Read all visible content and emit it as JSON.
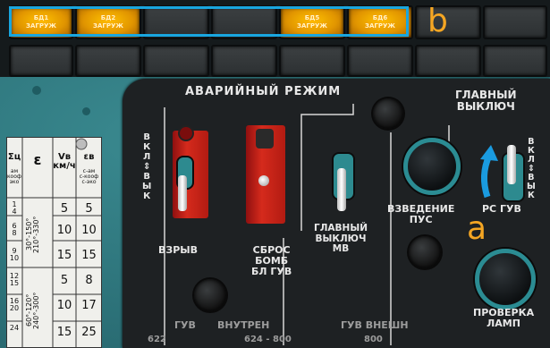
{
  "annunciators": {
    "row1": [
      {
        "label1": "БД1",
        "label2": "ЗАГРУЖ",
        "lit": true
      },
      {
        "label1": "БД2",
        "label2": "ЗАГРУЖ",
        "lit": true
      },
      {
        "label1": "",
        "label2": "",
        "lit": false
      },
      {
        "label1": "",
        "label2": "",
        "lit": false
      },
      {
        "label1": "БД5",
        "label2": "ЗАГРУЖ",
        "lit": true
      },
      {
        "label1": "БД6",
        "label2": "ЗАГРУЖ",
        "lit": true
      },
      {
        "label1": "",
        "label2": "",
        "lit": false
      },
      {
        "label1": "",
        "label2": "",
        "lit": false
      }
    ],
    "highlight_color": "#19a6df"
  },
  "callouts": {
    "b": "b",
    "a": "a",
    "color": "#f5a623"
  },
  "panel": {
    "title": "АВАРИЙНЫЙ РЕЖИМ",
    "main_switch_title": "ГЛАВНЫЙ\nВЫКЛЮЧ",
    "vkl_vykl_left": "В\nК\nЛ\n⇕\nВ\nЫ\nК",
    "vkl_vykl_right": "В\nК\nЛ\n⇕\nВ\nЫ\nК",
    "explosion": "ВЗРЫВ",
    "bomb_reset": "СБРОС\nБОМБ\nБЛ ГУВ",
    "main_switch_mv": "ГЛАВНЫЙ\nВЫКЛЮЧ\nМВ",
    "arming": "ВЗВЕДЕНИЕ\nПУС",
    "rs_guv": "РС ГУВ",
    "lamp_test": "ПРОВЕРКА\nЛАМП",
    "guv": "ГУВ",
    "internal": "ВНУТРЕН",
    "guv_external": "ГУВ ВНЕШН",
    "num_622": "622",
    "num_624_800": "624 - 800",
    "num_800": "800",
    "colors": {
      "guard_red": "#d52a1c",
      "ring_teal": "#2b8c93"
    }
  },
  "card": {
    "headers": [
      "Σц",
      "ε",
      "Vв км/ч",
      "εв"
    ],
    "subheaders": [
      "ам\nкооф\nэко",
      "",
      "",
      "с-ам\nс-кооф\nс-эко"
    ],
    "rows": [
      {
        "sc": "1\n4",
        "v": "5",
        "eb": "5"
      },
      {
        "sc": "6\n8",
        "v": "10",
        "eb": "10"
      },
      {
        "sc": "9\n10",
        "v": "15",
        "eb": "15"
      },
      {
        "sc": "12\n15",
        "v": "5",
        "eb": "8"
      },
      {
        "sc": "16\n20",
        "v": "10",
        "eb": "17"
      },
      {
        "sc": "24",
        "v": "15",
        "eb": "25"
      }
    ],
    "eps_group1": "30°-150°\n210°-330°",
    "eps_group2": "60°-120°\n240°-300°"
  }
}
